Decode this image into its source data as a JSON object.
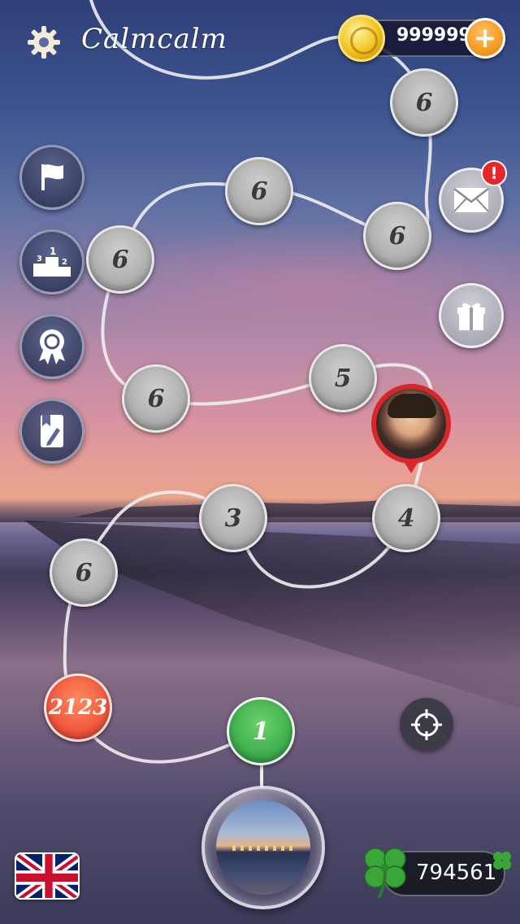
{
  "header": {
    "title": "Calmcalm",
    "coins": "999999",
    "settings_icon": "gear-icon",
    "coin_icon": "gold-coin-icon",
    "add_coins_icon": "plus-icon"
  },
  "side_menu": [
    {
      "name": "flag-icon"
    },
    {
      "name": "leaderboard-podium-icon"
    },
    {
      "name": "award-ribbon-icon"
    },
    {
      "name": "notebook-pencil-icon"
    }
  ],
  "right_buttons": {
    "mail_icon": "envelope-icon",
    "mail_badge": "!",
    "gift_icon": "gift-icon",
    "locate_icon": "crosshair-icon"
  },
  "levels": {
    "n1": "1",
    "n2123": "2123",
    "n6a": "6",
    "n3": "3",
    "n4": "4",
    "n5": "5",
    "n6b": "6",
    "n6c": "6",
    "n6d": "6",
    "n6e": "6",
    "n6f": "6"
  },
  "footer": {
    "language_flag": "uk-flag-icon",
    "clovers": "794561",
    "clover_icon": "four-leaf-clover-icon"
  },
  "colors": {
    "current_level": "#3aa94a",
    "highlight_level": "#f0503a",
    "locked_level": "#a9a9a9",
    "coin_add": "#f59a20",
    "badge": "#e6262a"
  }
}
